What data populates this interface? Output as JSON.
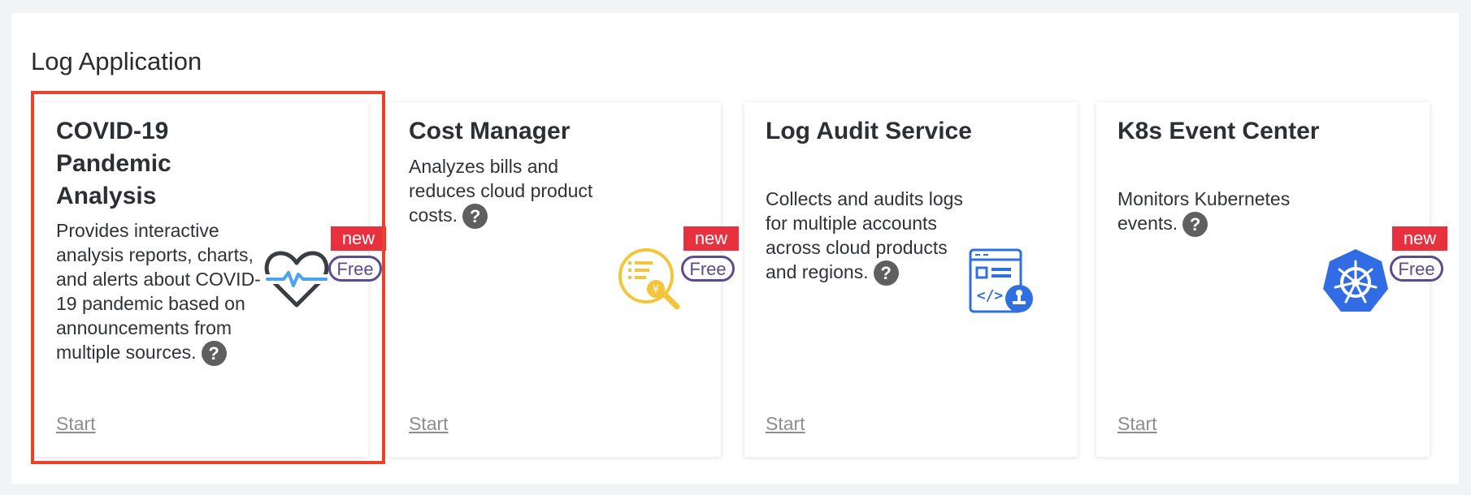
{
  "section": {
    "title": "Log Application"
  },
  "cards": [
    {
      "title": "COVID-19 Pandemic Analysis",
      "description": "Provides interactive analysis reports, charts, and alerts about COVID-19 pandemic based on announcements from multiple sources.",
      "help": "?",
      "badge_new": "new",
      "badge_free": "Free",
      "start": "Start",
      "icon": "heartbeat-icon",
      "selected": true
    },
    {
      "title": "Cost Manager",
      "description": "Analyzes bills and reduces cloud product costs.",
      "help": "?",
      "badge_new": "new",
      "badge_free": "Free",
      "start": "Start",
      "icon": "bill-magnifier-icon",
      "selected": false
    },
    {
      "title": "Log Audit Service",
      "description": "Collects and audits logs for multiple accounts across cloud products and regions.",
      "help": "?",
      "badge_new": "",
      "badge_free": "",
      "start": "Start",
      "icon": "code-document-stamp-icon",
      "selected": false
    },
    {
      "title": "K8s Event Center",
      "description": "Monitors Kubernetes events.",
      "help": "?",
      "badge_new": "new",
      "badge_free": "Free",
      "start": "Start",
      "icon": "kubernetes-icon",
      "selected": false
    }
  ],
  "colors": {
    "selection_border": "#e8432a",
    "badge_new": "#e8303f",
    "badge_free": "#5e4b8e",
    "cost_icon": "#f3c53a",
    "audit_icon": "#2f6fe0",
    "k8s_icon": "#326ce5"
  }
}
